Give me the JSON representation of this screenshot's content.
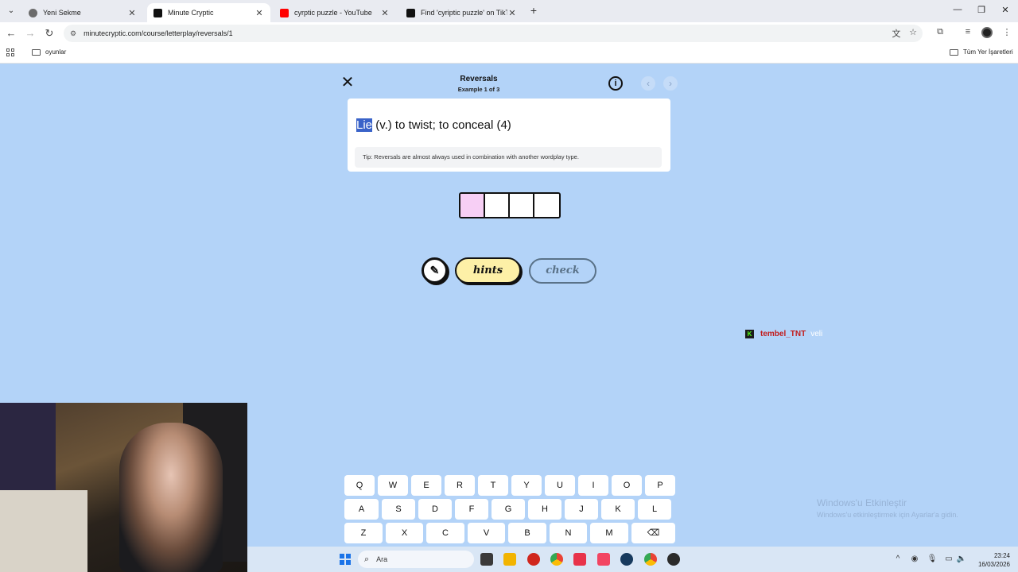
{
  "browser": {
    "tabs": [
      {
        "title": "Yeni Sekme",
        "favicon_color": "#6b6b6b",
        "active": false
      },
      {
        "title": "Minute Cryptic",
        "favicon_color": "#111111",
        "active": true
      },
      {
        "title": "cyrptic puzzle - YouTube",
        "favicon_color": "#ff0000",
        "active": false
      },
      {
        "title": "Find 'cyriptic puzzle' on TikTok",
        "favicon_color": "#111111",
        "active": false
      }
    ],
    "new_tab_label": "+",
    "url": "minutecryptic.com/course/letterplay/reversals/1",
    "bookmarks": {
      "left": "oyunlar",
      "right": "Tüm Yer İşaretleri"
    }
  },
  "page": {
    "title": "Reversals",
    "subtitle": "Example 1 of 3",
    "info_icon": "i",
    "clue": {
      "highlight": "Lie",
      "rest": " (v.) to twist; to conceal (4)"
    },
    "tip": "Tip: Reversals are almost always used in combination with another wordplay type.",
    "answer_length": 4,
    "buttons": {
      "hints": "hints",
      "check": "check"
    },
    "colors": {
      "background": "#b3d3f8",
      "active_cell": "#f7cff5",
      "hints_button": "#fdf0a7",
      "clue_highlight": "#3a63c9"
    }
  },
  "chat": {
    "badge": "K",
    "username": "tembel_TNT",
    "message": "veli"
  },
  "keyboard": {
    "rows": [
      [
        "Q",
        "W",
        "E",
        "R",
        "T",
        "Y",
        "U",
        "I",
        "O",
        "P"
      ],
      [
        "A",
        "S",
        "D",
        "F",
        "G",
        "H",
        "J",
        "K",
        "L"
      ],
      [
        "Z",
        "X",
        "C",
        "V",
        "B",
        "N",
        "M",
        "⌫"
      ]
    ]
  },
  "watermark": {
    "title": "Windows'u Etkinleştir",
    "body": "Windows'u etkinleştirmek için Ayarlar'a gidin."
  },
  "taskbar": {
    "search_placeholder": "Ara",
    "time": "23:24",
    "date": "16/03/2026"
  }
}
